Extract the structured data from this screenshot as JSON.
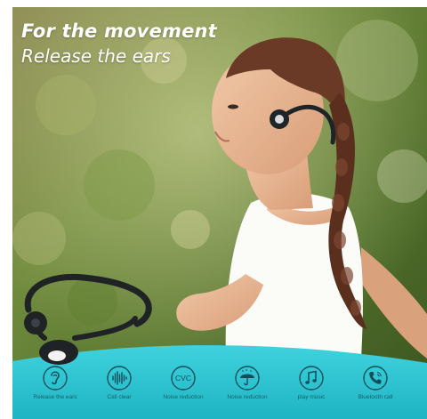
{
  "headline": {
    "line1": "For the movement",
    "line2": "Release the ears"
  },
  "colors": {
    "banner_teal": "#27c3d1",
    "icon_ink": "#0f4f5a",
    "headline_text": "#ffffff"
  },
  "features": [
    {
      "icon": "ear-icon",
      "label": "Release the ears"
    },
    {
      "icon": "soundwave-icon",
      "label": "Call clear"
    },
    {
      "icon": "cvc-icon",
      "glyph": "CVC",
      "label": "Noise reduction"
    },
    {
      "icon": "umbrella-icon",
      "label": "Noise reduction"
    },
    {
      "icon": "music-note-icon",
      "label": "play music"
    },
    {
      "icon": "phone-icon",
      "label": "Bluetooth call"
    }
  ]
}
